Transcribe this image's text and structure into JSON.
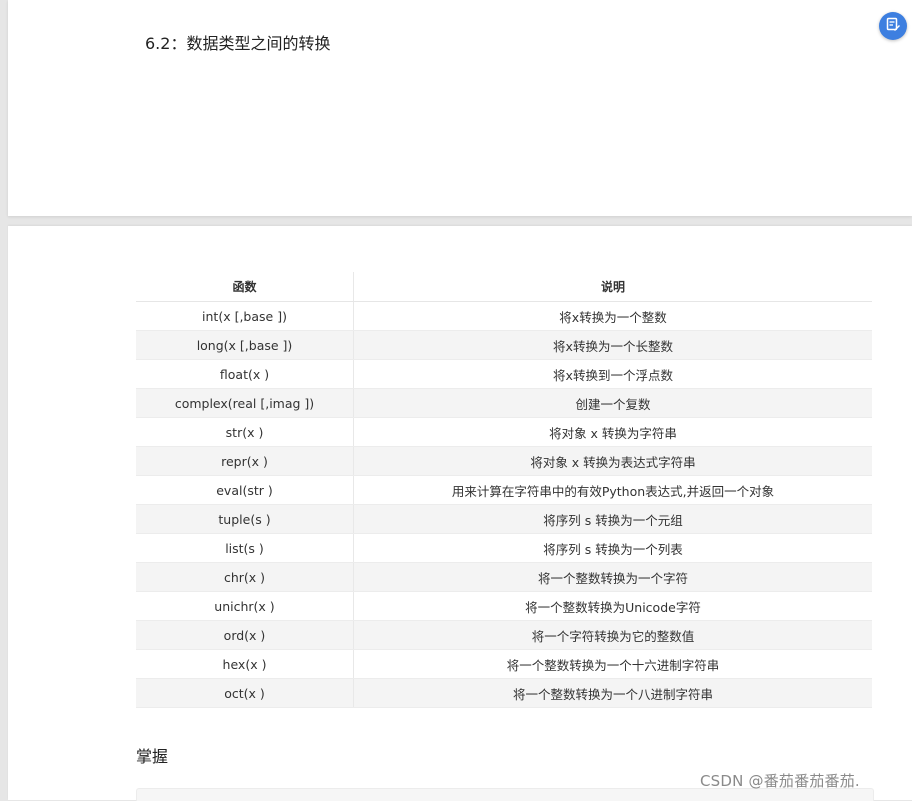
{
  "section_title": "6.2：数据类型之间的转换",
  "float_button_icon": "edit-note-icon",
  "table": {
    "headers": [
      "函数",
      "说明"
    ],
    "rows": [
      [
        "int(x [,base ])",
        "将x转换为一个整数"
      ],
      [
        "long(x [,base ])",
        "将x转换为一个长整数"
      ],
      [
        "float(x )",
        "将x转换到一个浮点数"
      ],
      [
        "complex(real [,imag ])",
        "创建一个复数"
      ],
      [
        "str(x )",
        "将对象 x 转换为字符串"
      ],
      [
        "repr(x )",
        "将对象 x 转换为表达式字符串"
      ],
      [
        "eval(str )",
        "用来计算在字符串中的有效Python表达式,并返回一个对象"
      ],
      [
        "tuple(s )",
        "将序列 s 转换为一个元组"
      ],
      [
        "list(s )",
        "将序列 s 转换为一个列表"
      ],
      [
        "chr(x )",
        "将一个整数转换为一个字符"
      ],
      [
        "unichr(x )",
        "将一个整数转换为Unicode字符"
      ],
      [
        "ord(x )",
        "将一个字符转换为它的整数值"
      ],
      [
        "hex(x )",
        "将一个整数转换为一个十六进制字符串"
      ],
      [
        "oct(x )",
        "将一个整数转换为一个八进制字符串"
      ]
    ]
  },
  "subheading": "掌握",
  "watermark": "CSDN @番茄番茄番茄."
}
